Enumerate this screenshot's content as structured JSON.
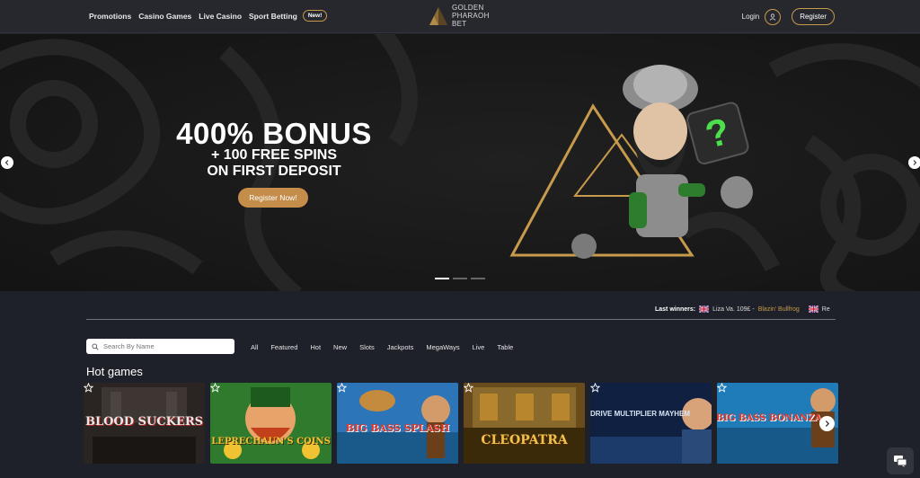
{
  "nav": {
    "links": [
      "Promotions",
      "Casino Games",
      "Live Casino",
      "Sport Betting"
    ],
    "new_badge": "New!",
    "logo_line1": "GOLDEN",
    "logo_line2": "PHARAOH",
    "logo_line3": "BET",
    "login": "Login",
    "register": "Register",
    "user_icon": "user-icon"
  },
  "hero": {
    "title": "400% BONUS",
    "subtitle_line1": "+ 100 FREE SPINS",
    "subtitle_line2": "ON FIRST DEPOSIT",
    "cta": "Register Now!",
    "slides": 3,
    "active_slide": 1
  },
  "winners": {
    "label": "Last winners:",
    "items": [
      {
        "name": "Liza Va. 109£ -",
        "game": "Blazin' Bullfrog"
      },
      {
        "name": "Re",
        "game": ""
      }
    ]
  },
  "search": {
    "placeholder": "Search By Name"
  },
  "filters": [
    "All",
    "Featured",
    "Hot",
    "New",
    "Slots",
    "Jackpots",
    "MegaWays",
    "Live",
    "Table"
  ],
  "section_title": "Hot games",
  "games": [
    {
      "title": "BLOOD SUCKERS",
      "bg": "#2a2523",
      "accent": "#b8231f"
    },
    {
      "title": "LEPRECHAUN'S COINS",
      "bg": "#2f7a2c",
      "accent": "#f1c232"
    },
    {
      "title": "BIG BASS SPLASH",
      "bg": "#2b75b8",
      "accent": "#e3362a"
    },
    {
      "title": "CLEOPATRA",
      "bg": "#6a4c1c",
      "accent": "#f0c24a"
    },
    {
      "title": "DRIVE MULTIPLIER MAYHEM",
      "bg": "#0f2040",
      "accent": "#d9e6f5"
    },
    {
      "title": "BIG BASS BONANZA",
      "bg": "#1f7cb8",
      "accent": "#e3362a"
    }
  ],
  "colors": {
    "gold": "#c79a4c",
    "nav_bg": "#26282e",
    "body_bg": "#1e2129"
  }
}
